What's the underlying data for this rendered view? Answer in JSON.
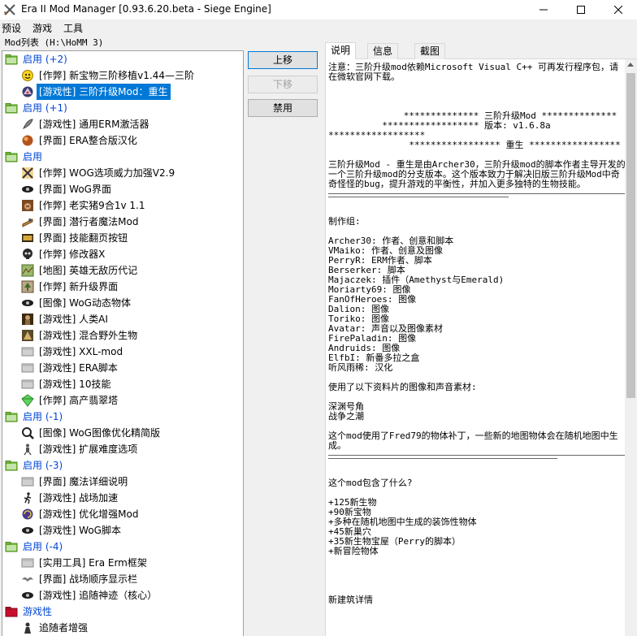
{
  "window": {
    "title": "Era II Mod Manager [0.93.6.20.beta - Siege Engine]",
    "minimize": "—",
    "maximize": "☐",
    "close": "✕"
  },
  "menu": [
    "预设",
    "游戏",
    "工具"
  ],
  "mod_list_caption": "Mod列表 (H:\\HoMM 3)",
  "tree": [
    {
      "type": "group",
      "label": "启用 (+2)",
      "icon": "folder-icon"
    },
    {
      "type": "item",
      "label": "[作弊] 新宝物三阶移植v1.44—三阶",
      "icon": "emoji-face-icon"
    },
    {
      "type": "item",
      "label": "[游戏性] 三阶升级Mod：重生",
      "icon": "dragon-icon",
      "selected": true
    },
    {
      "type": "group",
      "label": "启用 (+1)",
      "icon": "folder-icon"
    },
    {
      "type": "item",
      "label": "[游戏性] 通用ERM激活器",
      "icon": "feather-icon"
    },
    {
      "type": "item",
      "label": "[界面] ERA整合版汉化",
      "icon": "orb-icon"
    },
    {
      "type": "group",
      "label": "启用",
      "icon": "folder-icon"
    },
    {
      "type": "item",
      "label": "[作弊] WOG选项威力加强V2.9",
      "icon": "crossed-swords-icon"
    },
    {
      "type": "item",
      "label": "[界面] WoG界面",
      "icon": "eye-icon"
    },
    {
      "type": "item",
      "label": "[作弊] 老实猪9合1v 1.1",
      "icon": "pig-icon"
    },
    {
      "type": "item",
      "label": "[界面] 潜行者魔法Mod",
      "icon": "scroll-icon"
    },
    {
      "type": "item",
      "label": "[界面] 技能翻页按钮",
      "icon": "spellbook-icon"
    },
    {
      "type": "item",
      "label": "[作弊] 修改器X",
      "icon": "skull-icon"
    },
    {
      "type": "item",
      "label": "[地图] 英雄无敌历代记",
      "icon": "map-icon"
    },
    {
      "type": "item",
      "label": "[作弊] 新升级界面",
      "icon": "upgrade-icon"
    },
    {
      "type": "item",
      "label": "[图像] WoG动态物体",
      "icon": "eye-icon"
    },
    {
      "type": "item",
      "label": "[游戏性] 人类AI",
      "icon": "knight-icon"
    },
    {
      "type": "item",
      "label": "[游戏性] 混合野外生物",
      "icon": "creature-icon"
    },
    {
      "type": "item",
      "label": "[游戏性] XXL-mod",
      "icon": "blank-mod-icon"
    },
    {
      "type": "item",
      "label": "[游戏性] ERA脚本",
      "icon": "blank-mod-icon"
    },
    {
      "type": "item",
      "label": "[游戏性] 10技能",
      "icon": "blank-mod-icon"
    },
    {
      "type": "item",
      "label": "[作弊] 高产翡翠塔",
      "icon": "gem-icon"
    },
    {
      "type": "group",
      "label": "启用 (-1)",
      "icon": "folder-icon"
    },
    {
      "type": "item",
      "label": "[图像] WoG图像优化精简版",
      "icon": "magnifier-icon"
    },
    {
      "type": "item",
      "label": "[游戏性] 扩展难度选项",
      "icon": "figure-icon"
    },
    {
      "type": "group",
      "label": "启用 (-3)",
      "icon": "folder-icon"
    },
    {
      "type": "item",
      "label": "[界面] 魔法详细说明",
      "icon": "blank-mod-icon"
    },
    {
      "type": "item",
      "label": "[游戏性] 战场加速",
      "icon": "running-man-icon"
    },
    {
      "type": "item",
      "label": "[游戏性] 优化增强Mod",
      "icon": "swirl-icon"
    },
    {
      "type": "item",
      "label": "[游戏性] WoG脚本",
      "icon": "eye-icon"
    },
    {
      "type": "group",
      "label": "启用 (-4)",
      "icon": "folder-icon"
    },
    {
      "type": "item",
      "label": "[实用工具] Era Erm框架",
      "icon": "blank-mod-icon"
    },
    {
      "type": "item",
      "label": "[界面] 战场顺序显示栏",
      "icon": "wings-icon"
    },
    {
      "type": "item",
      "label": "[游戏性] 追随神迹（核心）",
      "icon": "eye-icon"
    },
    {
      "type": "group",
      "label": "游戏性",
      "icon": "red-folder-icon",
      "red": true
    },
    {
      "type": "item",
      "label": "追随者增强",
      "icon": "follower-icon"
    }
  ],
  "buttons": {
    "move_up": "上移",
    "move_down": "下移",
    "disable": "禁用"
  },
  "tabs": [
    "说明",
    "信息",
    "截图"
  ],
  "doc": [
    {
      "t": "p",
      "v": "注意：三阶升级mod依赖Microsoft Visual C++ 可再发行程序包，请在微软官网下载。"
    },
    {
      "t": "gap"
    },
    {
      "t": "gap"
    },
    {
      "t": "gap"
    },
    {
      "t": "p",
      "v": "              ************** 三阶升级Mod **************"
    },
    {
      "t": "p",
      "v": "          ****************** 版本: v1.6.8a"
    },
    {
      "t": "p",
      "v": "******************"
    },
    {
      "t": "p",
      "v": "               ***************** 重生 *****************"
    },
    {
      "t": "gap"
    },
    {
      "t": "p",
      "v": "三阶升级Mod - 重生是由Archer30，三阶升级mod的脚本作者主导开发的一个三阶升级mod的分支版本。这个版本致力于解决旧版三阶升级Mod中奇奇怪怪的bug，提升游戏的平衡性，并加入更多独特的生物技能。"
    },
    {
      "t": "hr"
    },
    {
      "t": "hr-short"
    },
    {
      "t": "gap"
    },
    {
      "t": "gap"
    },
    {
      "t": "p",
      "v": "制作组:"
    },
    {
      "t": "gap"
    },
    {
      "t": "p",
      "v": "Archer30: 作者、创意和脚本"
    },
    {
      "t": "p",
      "v": "VMaiko: 作者、创意及图像"
    },
    {
      "t": "p",
      "v": "PerryR: ERM作者、脚本"
    },
    {
      "t": "p",
      "v": "Berserker: 脚本"
    },
    {
      "t": "p",
      "v": "Majaczek: 插件（Amethyst与Emerald)"
    },
    {
      "t": "p",
      "v": "Moriarty69: 图像"
    },
    {
      "t": "p",
      "v": "FanOfHeroes: 图像"
    },
    {
      "t": "p",
      "v": "Dalion: 图像"
    },
    {
      "t": "p",
      "v": "Toriko: 图像"
    },
    {
      "t": "p",
      "v": "Avatar: 声音以及图像素材"
    },
    {
      "t": "p",
      "v": "FirePaladin: 图像"
    },
    {
      "t": "p",
      "v": "Andruids: 图像"
    },
    {
      "t": "p",
      "v": "ElfbI: 新番多拉之盒"
    },
    {
      "t": "p",
      "v": "听风雨稀: 汉化"
    },
    {
      "t": "gap"
    },
    {
      "t": "p",
      "v": "使用了以下资料片的图像和声音素材:"
    },
    {
      "t": "gap"
    },
    {
      "t": "p",
      "v": "深渊号角"
    },
    {
      "t": "p",
      "v": "战争之潮"
    },
    {
      "t": "gap"
    },
    {
      "t": "p",
      "v": "这个mod使用了Fred79的物体补丁，一些新的地图物体会在随机地图中生成。"
    },
    {
      "t": "hr"
    },
    {
      "t": "hr-mid"
    },
    {
      "t": "gap"
    },
    {
      "t": "gap"
    },
    {
      "t": "p",
      "v": "这个mod包含了什么?"
    },
    {
      "t": "gap"
    },
    {
      "t": "p",
      "v": "+125新生物"
    },
    {
      "t": "p",
      "v": "+90新宝物"
    },
    {
      "t": "p",
      "v": "+多种在随机地图中生成的装饰性物体"
    },
    {
      "t": "p",
      "v": "+45新巢穴"
    },
    {
      "t": "p",
      "v": "+35新生物宝屋（Perry的脚本）"
    },
    {
      "t": "p",
      "v": "+新冒险物体"
    },
    {
      "t": "gap"
    },
    {
      "t": "gap"
    },
    {
      "t": "gap"
    },
    {
      "t": "gap"
    },
    {
      "t": "p",
      "v": "新建筑详情"
    }
  ]
}
